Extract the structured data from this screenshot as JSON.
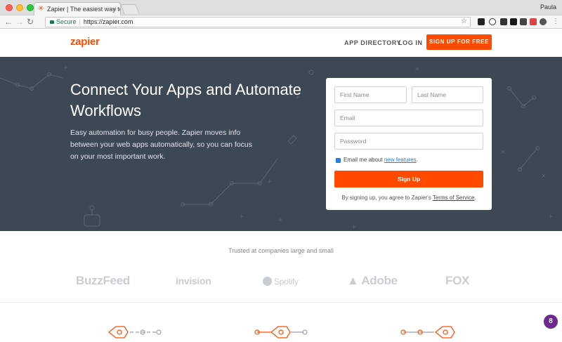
{
  "browser": {
    "tab_title": "Zapier | The easiest way to au",
    "tab_favicon": "✳",
    "profile_name": "Paula",
    "address_secure": "Secure",
    "address_url": "https://zapier.com"
  },
  "nav": {
    "logo": "zapier",
    "app_directory": "APP DIRECTORY",
    "log_in": "LOG IN",
    "signup": "SIGN UP FOR FREE"
  },
  "hero": {
    "headline": "Connect Your Apps and Automate Workflows",
    "subtext": "Easy automation for busy people. Zapier moves info between your web apps automatically, so you can focus on your most important work."
  },
  "form": {
    "first_name_placeholder": "First Name",
    "last_name_placeholder": "Last Name",
    "email_placeholder": "Email",
    "password_placeholder": "Password",
    "email_opt_prefix": "Email me about ",
    "email_opt_link": "new features",
    "email_opt_suffix": ".",
    "signup_button": "Sign Up",
    "terms_prefix": "By signing up, you agree to Zapier's ",
    "terms_link": "Terms of Service",
    "terms_suffix": "."
  },
  "trusted": {
    "heading": "Trusted at companies large and small",
    "brands": [
      "BuzzFeed",
      "invision",
      "Spotify",
      "Adobe",
      "FOX"
    ]
  },
  "chat_badge": "8",
  "colors": {
    "brand": "#ff4a00",
    "hero_bg": "#3d4855",
    "badge": "#6c2a8c"
  }
}
